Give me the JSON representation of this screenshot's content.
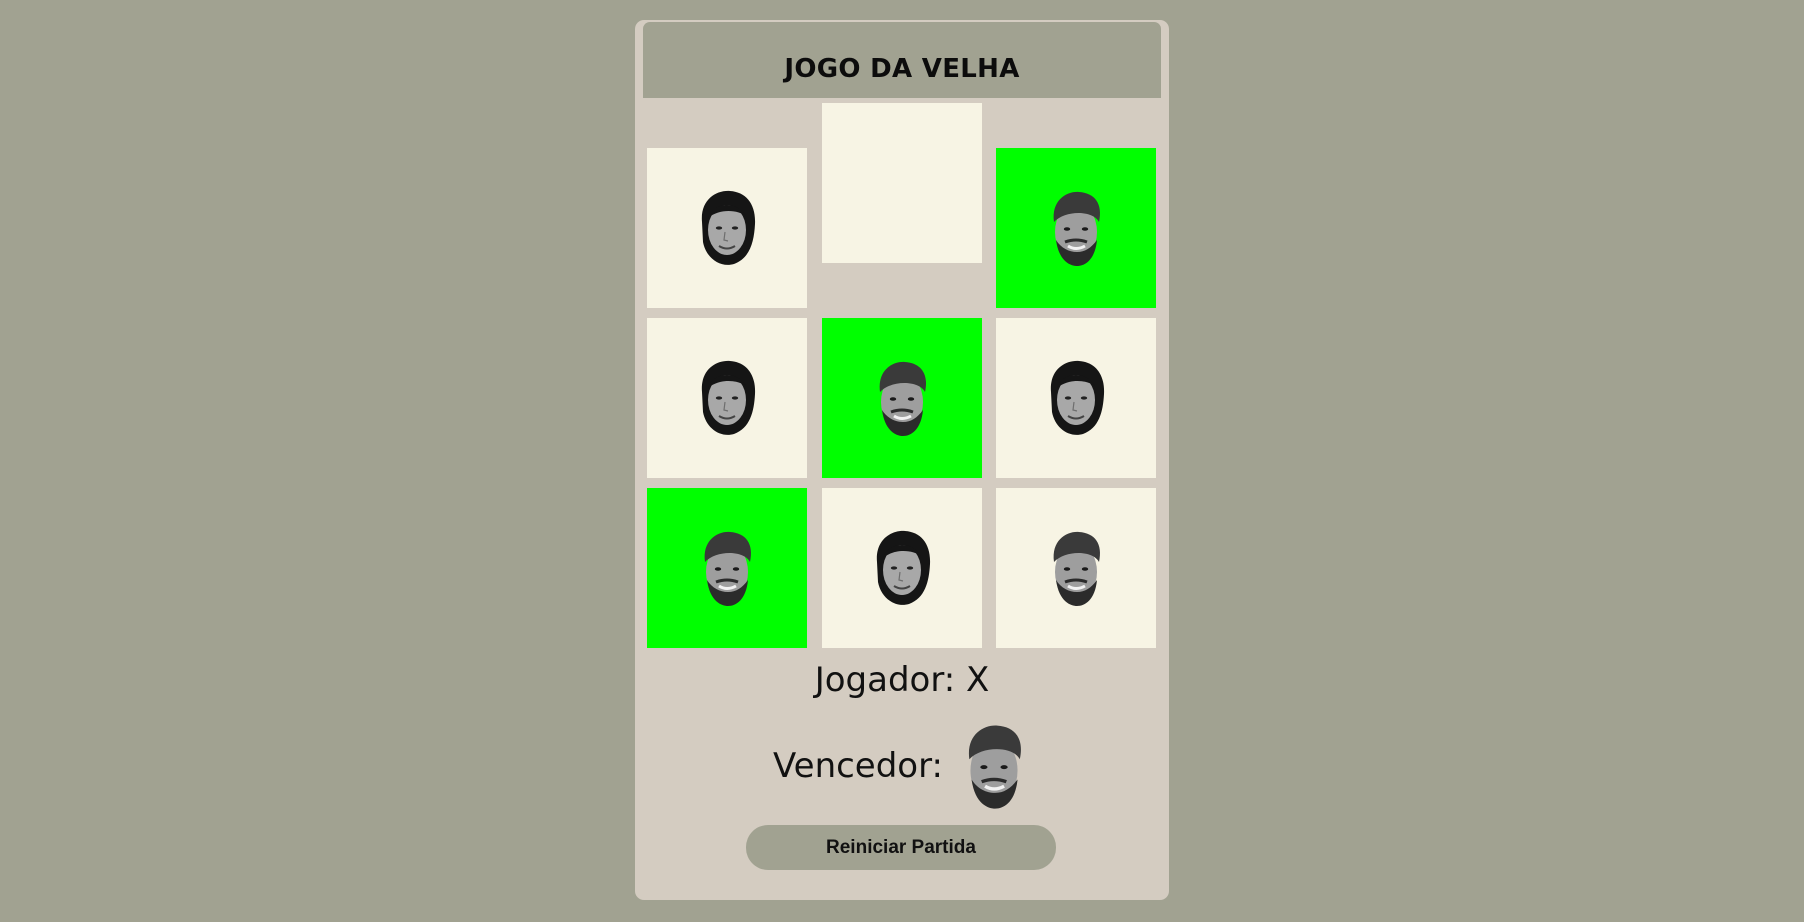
{
  "title": "JOGO DA VELHA",
  "board": [
    {
      "piece": "woman",
      "highlight": false
    },
    {
      "piece": "",
      "highlight": false
    },
    {
      "piece": "man",
      "highlight": true
    },
    {
      "piece": "woman",
      "highlight": false
    },
    {
      "piece": "man",
      "highlight": true
    },
    {
      "piece": "woman",
      "highlight": false
    },
    {
      "piece": "man",
      "highlight": true
    },
    {
      "piece": "woman",
      "highlight": false
    },
    {
      "piece": "man",
      "highlight": false
    }
  ],
  "status": {
    "player_label": "Jogador: X",
    "winner_label": "Vencedor:",
    "winner_piece": "man"
  },
  "reset_label": "Reiniciar Partida",
  "colors": {
    "background": "#a1a291",
    "card": "#d4ccc1",
    "cell": "#f7f4e4",
    "win_cell": "#00ff00"
  }
}
